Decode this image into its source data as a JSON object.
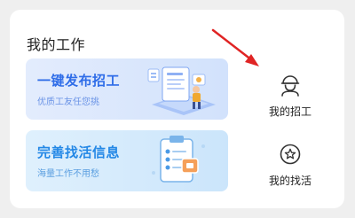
{
  "section": {
    "title": "我的工作"
  },
  "banners": [
    {
      "title": "一键发布招工",
      "subtitle": "优质工友任您挑",
      "accent": "#2f6de8"
    },
    {
      "title": "完善找活信息",
      "subtitle": "海量工作不用愁",
      "accent": "#2488e6"
    }
  ],
  "side_items": [
    {
      "label": "我的招工",
      "icon": "worker-helmet-icon"
    },
    {
      "label": "我的找活",
      "icon": "star-badge-icon"
    }
  ],
  "colors": {
    "arrow": "#e02424",
    "background": "#efefef",
    "card": "#ffffff"
  }
}
